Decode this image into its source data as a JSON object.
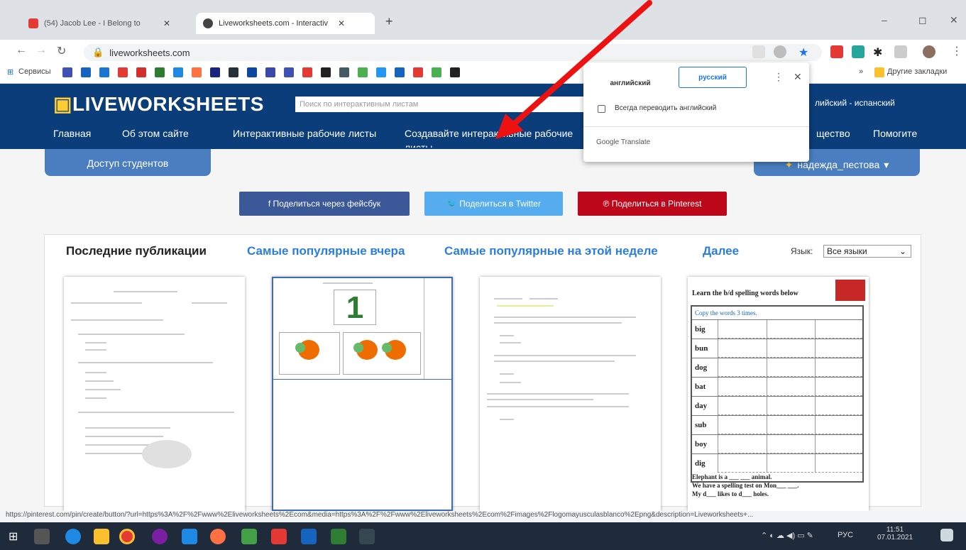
{
  "browser": {
    "tabs": [
      {
        "label": "(54) Jacob Lee - I Belong to",
        "icon_color": "#e53935"
      },
      {
        "label": "Liveworksheets.com - Interactiv",
        "icon_color": "#444444"
      }
    ],
    "url": "liveworksheets.com",
    "new_tab_icon": "+",
    "min_icon": "–",
    "max_icon": "◻",
    "close_icon": "✕"
  },
  "bookmarks": {
    "apps_label": "Сервисы",
    "other_label": "Другие закладки",
    "chevron": "»",
    "colors": [
      "#3f51b5",
      "#1565c0",
      "#1976d2",
      "#e53935",
      "#d32f2f",
      "#2e7d32",
      "#1e88e5",
      "#ff7043",
      "#1a237e",
      "#263238",
      "#0d47a1",
      "#3949ab",
      "#3f51b5",
      "#e53935",
      "#212121",
      "#455a64",
      "#4caf50",
      "#2196f3",
      "#1565c0",
      "#e53935",
      "#4caf50",
      "#212121"
    ]
  },
  "translate": {
    "tab_en": "английский",
    "tab_ru": "русский",
    "always_label": "Всегда переводить английский",
    "footer": "Google Translate",
    "more_icon": "⋮",
    "close_icon": "✕"
  },
  "site": {
    "logo_prefix": "▣",
    "logo": "LIVEWORKSHEETS",
    "search_placeholder": "Поиск по интерактивным листам",
    "lang_links": "лийский  -  испанский",
    "nav": {
      "home": "Главная",
      "about": "Об этом сайте",
      "worksheets": "Интерактивные рабочие листы",
      "create": "Создавайте интерактивные рабочие листы",
      "community": "щество",
      "help": "Помогите"
    },
    "student_access": "Доступ студентов",
    "user": "надежда_пестова",
    "user_caret": "▾",
    "share_fb": "f  Поделиться через фейсбук",
    "share_tw": "🐦 Поделиться в Twitter",
    "share_pin": "℗  Поделиться в Pinterest",
    "colors": {
      "fb": "#3b5998",
      "tw": "#55acee",
      "pin": "#bd081c"
    }
  },
  "main": {
    "tab_latest": "Последние публикации",
    "tab_yesterday": "Самые популярные вчера",
    "tab_week": "Самые популярные на этой неделе",
    "tab_more": "Далее",
    "lang_label": "Язык:",
    "lang_value": "Все языки",
    "lang_caret": "⌄",
    "thumb2_number": "1",
    "thumb4_title": "Learn the b/d spelling words below",
    "thumb4_copy": "Copy the words 3 times.",
    "thumb4_words": [
      "big",
      "bun",
      "dog",
      "bat",
      "day",
      "sub",
      "boy",
      "dig"
    ],
    "thumb4_lines": [
      "Elephant is a ___ ___ animal.",
      "We have a spelling test on Mon___ ___.",
      "My d___ likes to d___ holes."
    ]
  },
  "status_url": "https://pinterest.com/pin/create/button/?url=https%3A%2F%2Fwww%2Eliveworksheets%2Ecom&media=https%3A%2F%2Fwww%2Eliveworksheets%2Ecom%2Fimages%2Flogomayusculasblanco%2Epng&description=Liveworksheets+...",
  "taskbar": {
    "time": "11:51",
    "date": "07.01.2021",
    "lang": "РУС"
  }
}
